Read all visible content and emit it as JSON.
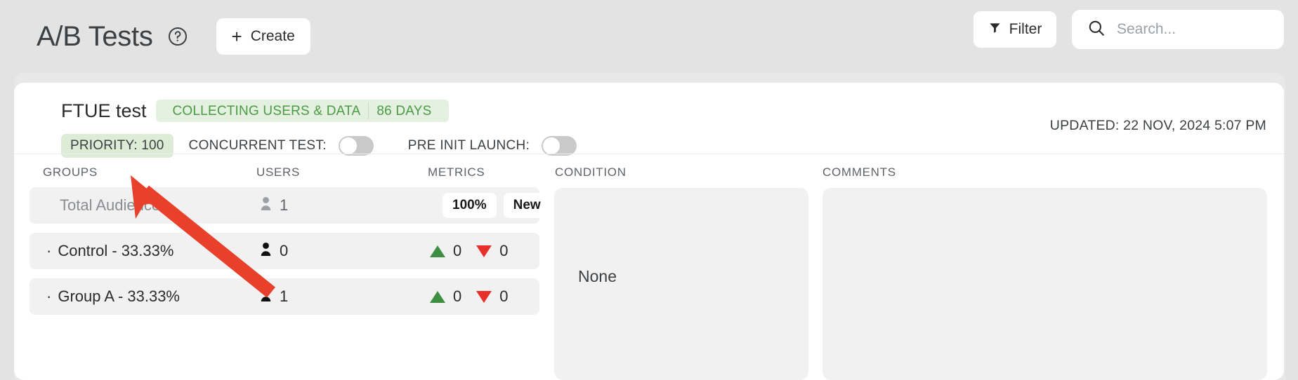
{
  "header": {
    "title": "A/B Tests",
    "help_icon": "question-circle-icon",
    "create_label": "Create",
    "create_plus": "+",
    "filter_label": "Filter",
    "filter_icon": "funnel-icon",
    "search_icon": "search-icon",
    "search_value": "",
    "search_placeholder": "Search..."
  },
  "test": {
    "name": "FTUE test",
    "status": "COLLECTING USERS & DATA",
    "duration": "86 DAYS",
    "priority": "PRIORITY: 100",
    "concurrent_label": "CONCURRENT TEST:",
    "concurrent_on": false,
    "preinit_label": "PRE INIT LAUNCH:",
    "preinit_on": false,
    "updated": "UPDATED: 22 NOV, 2024 5:07 PM",
    "menu_icon": "kebab-menu-icon"
  },
  "columns": {
    "groups": "GROUPS",
    "users": "USERS",
    "metrics": "METRICS",
    "condition": "CONDITION",
    "comments": "COMMENTS"
  },
  "rows": [
    {
      "name": "Total Audience",
      "bullet": "",
      "users": "1",
      "user_icon": "person-icon",
      "muted": true,
      "badges": [
        "100%",
        "New"
      ]
    },
    {
      "name": "Control - 33.33%",
      "bullet": "·",
      "users": "0",
      "user_icon": "person-icon",
      "muted": false,
      "metrics": {
        "up_icon": "triangle-up-icon",
        "up": "0",
        "down_icon": "triangle-down-icon",
        "down": "0"
      }
    },
    {
      "name": "Group A - 33.33%",
      "bullet": "·",
      "users": "1",
      "user_icon": "person-icon",
      "muted": false,
      "metrics": {
        "up_icon": "triangle-up-icon",
        "up": "0",
        "down_icon": "triangle-down-icon",
        "down": "0"
      }
    }
  ],
  "condition": {
    "value": "None"
  },
  "comments": {
    "value": ""
  },
  "annotation": {
    "icon": "red-arrow-annotation",
    "color": "#e8402a"
  },
  "colors": {
    "accent_green": "#4b9b45",
    "pill_green_bg": "#e4f0e0",
    "priority_bg": "#dcecd6",
    "metric_up": "#3e8e41",
    "metric_down": "#e8302a",
    "page_bg": "#e3e3e3",
    "card_bg": "#ffffff"
  }
}
